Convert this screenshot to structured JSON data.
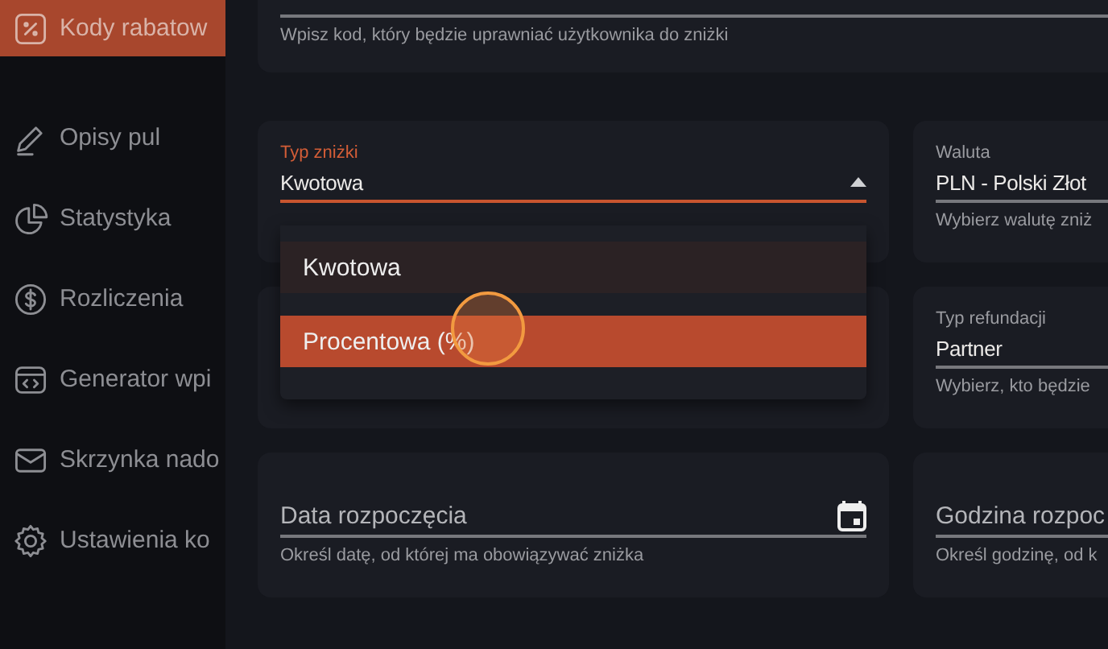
{
  "sidebar": {
    "items": [
      {
        "label": "Kody rabatow",
        "selected": true
      },
      {
        "label": "Opisy pul",
        "selected": false
      },
      {
        "label": "Statystyka",
        "selected": false
      },
      {
        "label": "Rozliczenia",
        "selected": false
      },
      {
        "label": "Generator wpi",
        "selected": false
      },
      {
        "label": "Skrzynka nado",
        "selected": false
      },
      {
        "label": "Ustawienia ko",
        "selected": false
      }
    ]
  },
  "code_field": {
    "helper": "Wpisz kod, który będzie uprawniać użytkownika do zniżki"
  },
  "discount_type": {
    "label": "Typ zniżki",
    "value": "Kwotowa",
    "focused": true,
    "expanded": true,
    "options": [
      {
        "label": "Kwotowa",
        "selected": true,
        "highlighted": false
      },
      {
        "label": "Procentowa (%)",
        "selected": false,
        "highlighted": true
      }
    ]
  },
  "currency": {
    "label": "Waluta",
    "value": "PLN - Polski Złot",
    "helper": "Wybierz walutę zniż"
  },
  "refund_type": {
    "label": "Typ refundacji",
    "value": "Partner",
    "helper": "Wybierz, kto będzie"
  },
  "start_date": {
    "placeholder": "Data rozpoczęcia",
    "helper": "Określ datę, od której ma obowiązywać zniżka"
  },
  "start_time": {
    "placeholder": "Godzina rozpoc",
    "helper": "Określ godzinę, od k"
  }
}
